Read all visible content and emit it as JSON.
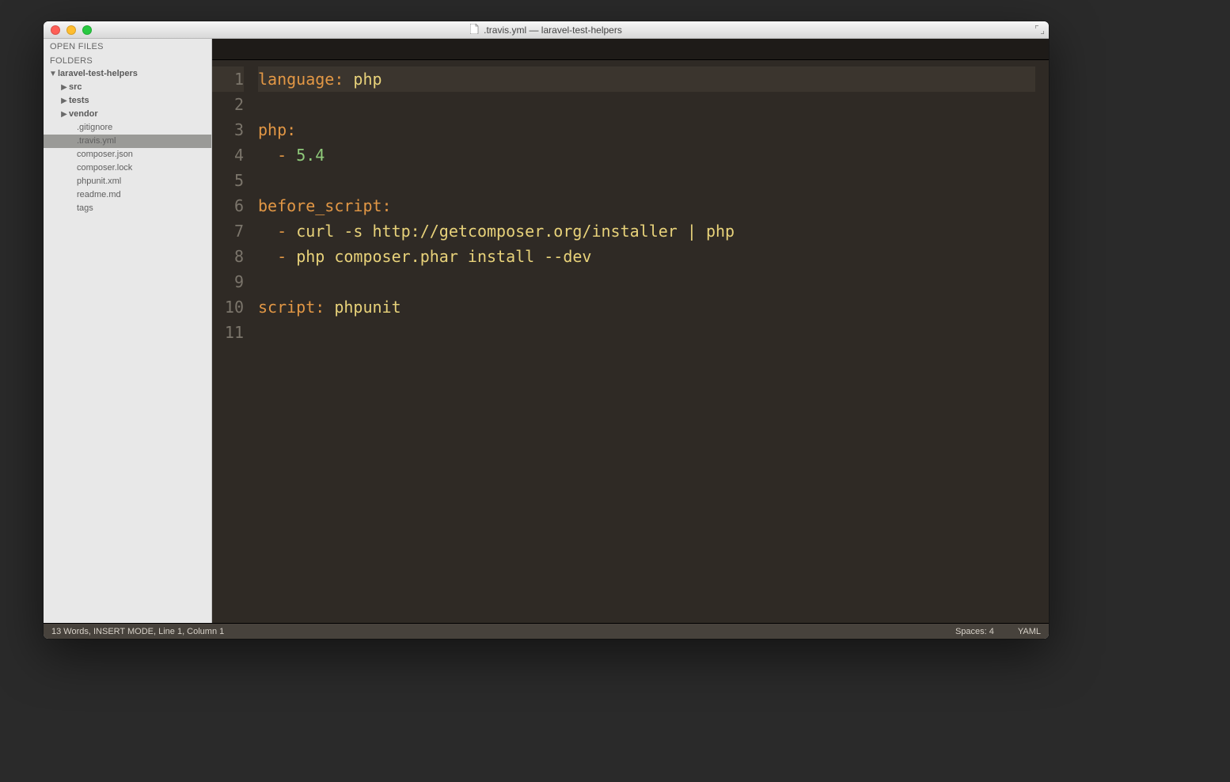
{
  "window_title": ".travis.yml — laravel-test-helpers",
  "sidebar": {
    "open_files_label": "OPEN FILES",
    "folders_label": "FOLDERS",
    "root_folder": "laravel-test-helpers",
    "folders": [
      "src",
      "tests",
      "vendor"
    ],
    "files": [
      ".gitignore",
      ".travis.yml",
      "composer.json",
      "composer.lock",
      "phpunit.xml",
      "readme.md",
      "tags"
    ],
    "active_file": ".travis.yml"
  },
  "code": {
    "tokens": [
      [
        [
          "key",
          "language:"
        ],
        [
          "plain",
          " "
        ],
        [
          "str",
          "php"
        ]
      ],
      [],
      [
        [
          "key",
          "php:"
        ]
      ],
      [
        [
          "plain",
          "  "
        ],
        [
          "key",
          "-"
        ],
        [
          "plain",
          " "
        ],
        [
          "num",
          "5.4"
        ]
      ],
      [],
      [
        [
          "key",
          "before_script:"
        ]
      ],
      [
        [
          "plain",
          "  "
        ],
        [
          "key",
          "-"
        ],
        [
          "plain",
          " "
        ],
        [
          "str",
          "curl -s http://getcomposer.org/installer | php"
        ]
      ],
      [
        [
          "plain",
          "  "
        ],
        [
          "key",
          "-"
        ],
        [
          "plain",
          " "
        ],
        [
          "str",
          "php composer.phar install --dev"
        ]
      ],
      [],
      [
        [
          "key",
          "script:"
        ],
        [
          "plain",
          " "
        ],
        [
          "str",
          "phpunit"
        ]
      ],
      []
    ],
    "current_line": 1
  },
  "status": {
    "left": "13 Words, INSERT MODE, Line 1, Column 1",
    "spaces": "Spaces: 4",
    "syntax": "YAML"
  }
}
